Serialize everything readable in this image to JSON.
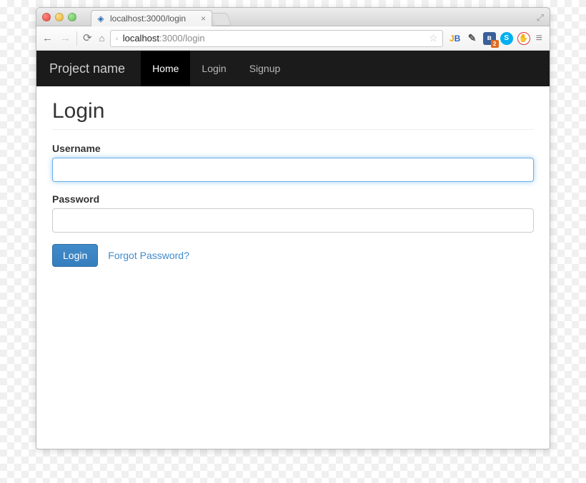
{
  "browser": {
    "tab": {
      "title": "localhost:3000/login"
    },
    "url": {
      "host": "localhost",
      "path": ":3000/login"
    }
  },
  "navbar": {
    "brand": "Project name",
    "links": [
      {
        "label": "Home",
        "active": true
      },
      {
        "label": "Login",
        "active": false
      },
      {
        "label": "Signup",
        "active": false
      }
    ]
  },
  "page": {
    "title": "Login",
    "username_label": "Username",
    "password_label": "Password",
    "login_button": "Login",
    "forgot_link": "Forgot Password?"
  }
}
